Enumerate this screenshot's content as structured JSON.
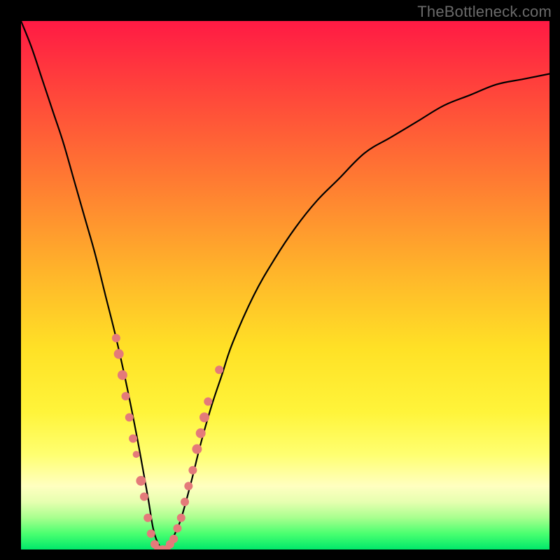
{
  "watermark": "TheBottleneck.com",
  "chart_data": {
    "type": "line",
    "title": "",
    "xlabel": "",
    "ylabel": "",
    "xlim": [
      0,
      100
    ],
    "ylim": [
      0,
      100
    ],
    "grid": false,
    "series": [
      {
        "name": "bottleneck-curve",
        "x": [
          0,
          2,
          4,
          6,
          8,
          10,
          12,
          14,
          16,
          18,
          20,
          22,
          24,
          25,
          26,
          27,
          28,
          30,
          32,
          34,
          36,
          38,
          40,
          44,
          48,
          52,
          56,
          60,
          65,
          70,
          75,
          80,
          85,
          90,
          95,
          100
        ],
        "values": [
          100,
          95,
          89,
          83,
          77,
          70,
          63,
          56,
          48,
          40,
          31,
          21,
          10,
          4,
          1,
          0,
          1,
          5,
          12,
          20,
          27,
          33,
          39,
          48,
          55,
          61,
          66,
          70,
          75,
          78,
          81,
          84,
          86,
          88,
          89,
          90
        ]
      }
    ],
    "scatter": {
      "name": "data-points",
      "color": "#e47a7a",
      "points": [
        {
          "x": 18.0,
          "y": 40,
          "r": 6
        },
        {
          "x": 18.5,
          "y": 37,
          "r": 7
        },
        {
          "x": 19.2,
          "y": 33,
          "r": 7
        },
        {
          "x": 19.8,
          "y": 29,
          "r": 6
        },
        {
          "x": 20.5,
          "y": 25,
          "r": 6
        },
        {
          "x": 21.2,
          "y": 21,
          "r": 6
        },
        {
          "x": 21.8,
          "y": 18,
          "r": 5
        },
        {
          "x": 22.7,
          "y": 13,
          "r": 7
        },
        {
          "x": 23.3,
          "y": 10,
          "r": 6
        },
        {
          "x": 24.0,
          "y": 6,
          "r": 6
        },
        {
          "x": 24.6,
          "y": 3,
          "r": 6
        },
        {
          "x": 25.3,
          "y": 1,
          "r": 6
        },
        {
          "x": 26.0,
          "y": 0,
          "r": 6
        },
        {
          "x": 26.8,
          "y": 0,
          "r": 6
        },
        {
          "x": 27.5,
          "y": 0,
          "r": 6
        },
        {
          "x": 28.2,
          "y": 1,
          "r": 6
        },
        {
          "x": 28.9,
          "y": 2,
          "r": 6
        },
        {
          "x": 29.6,
          "y": 4,
          "r": 6
        },
        {
          "x": 30.3,
          "y": 6,
          "r": 6
        },
        {
          "x": 31.0,
          "y": 9,
          "r": 6
        },
        {
          "x": 31.7,
          "y": 12,
          "r": 6
        },
        {
          "x": 32.5,
          "y": 15,
          "r": 6
        },
        {
          "x": 33.3,
          "y": 19,
          "r": 7
        },
        {
          "x": 34.0,
          "y": 22,
          "r": 7
        },
        {
          "x": 34.7,
          "y": 25,
          "r": 7
        },
        {
          "x": 35.4,
          "y": 28,
          "r": 6
        },
        {
          "x": 37.5,
          "y": 34,
          "r": 6
        }
      ]
    }
  }
}
